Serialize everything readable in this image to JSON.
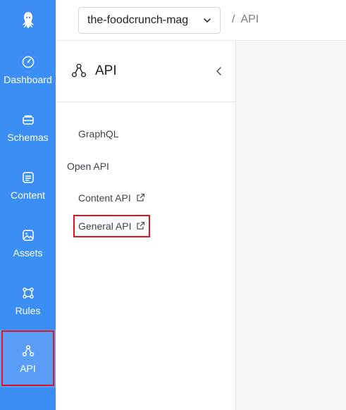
{
  "rail": {
    "items": [
      {
        "label": "Dashboard",
        "icon": "dashboard-gauge-icon"
      },
      {
        "label": "Schemas",
        "icon": "schemas-icon"
      },
      {
        "label": "Content",
        "icon": "content-icon"
      },
      {
        "label": "Assets",
        "icon": "assets-image-icon"
      },
      {
        "label": "Rules",
        "icon": "rules-icon"
      },
      {
        "label": "API",
        "icon": "api-nodes-icon"
      }
    ],
    "active": "API"
  },
  "header": {
    "app_select": "the-foodcrunch-mag",
    "breadcrumb": "/  API"
  },
  "panel": {
    "title": "API",
    "items": [
      {
        "label": "GraphQL"
      },
      {
        "label": "Open API"
      },
      {
        "label": "Content API"
      },
      {
        "label": "General API"
      }
    ]
  },
  "colors": {
    "rail": "#3b8ef3",
    "active": "#5a9ef7",
    "highlight": "#e0141e"
  }
}
